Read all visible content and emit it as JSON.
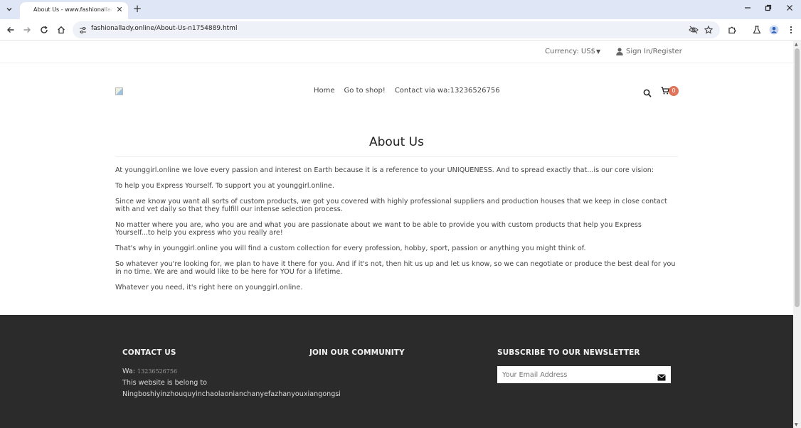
{
  "browser": {
    "tab_title": "About Us - www.fashionallady.online",
    "url": "fashionallady.online/About-Us-n1754889.html"
  },
  "topbar": {
    "currency": "Currency: US$",
    "signin": "Sign In/Register"
  },
  "nav": {
    "items": [
      "Home",
      "Go to shop!",
      "Contact via wa:13236526756"
    ],
    "cart_count": "0"
  },
  "page": {
    "title": "About Us",
    "paragraphs": [
      "At younggirl.online we love every passion and interest on Earth because it is a reference to your UNIQUENESS. And to spread exactly that...is our core vision:",
      "To help you Express Yourself. To support you at younggirl.online.",
      "Since we know you want all sorts of custom products, we got you covered with highly professional suppliers and production houses that we keep in close contact with and vet daily so that they fulfill our intense selection process.",
      "No matter where you are, who you are and what you are passionate about we want to be able to provide you with custom products that help you Express Yourself...to help you express who you really are!",
      "That's why in younggirl.online you will find a custom collection for every profession, hobby, sport, passion or anything you might think of.",
      "So whatever you're looking for, we plan to have it there for you. And if it's not, then hit us up and let us know, so we can negotiate or produce the best deal for you in no time. We are and would like to be here for YOU for a lifetime.",
      "Whatever you need, it's right here on younggirl.online."
    ]
  },
  "footer": {
    "contact_heading": "CONTACT US",
    "wa_label": "Wa:",
    "wa_number": "13236526756",
    "belong_line1": "This website is belong to",
    "belong_line2": "Ningboshiyinzhouquyinchaolaonianchanyefazhanyouxiangongsi",
    "community_heading": "JOIN OUR COMMUNITY",
    "newsletter_heading": "SUBSCRIBE TO OUR NEWSLETTER",
    "email_placeholder": "Your Email Address"
  },
  "icons": {
    "tab_dropdown": "chevron-down-icon",
    "close": "close-icon",
    "new_tab": "plus-icon",
    "back": "back-arrow-icon",
    "forward": "forward-arrow-icon",
    "reload": "reload-icon",
    "home": "home-icon",
    "site_info": "site-info-icon",
    "eye_off": "eye-off-icon",
    "star": "star-icon",
    "extensions": "puzzle-icon",
    "labs": "flask-icon",
    "profile": "profile-icon",
    "menu": "kebab-menu-icon",
    "user": "user-icon",
    "search": "search-icon",
    "cart": "cart-icon",
    "send": "envelope-icon"
  },
  "colors": {
    "tabstrip": "#dfe6f5",
    "cart_badge": "#e0745a",
    "footer_bg": "#2b2b2b"
  }
}
